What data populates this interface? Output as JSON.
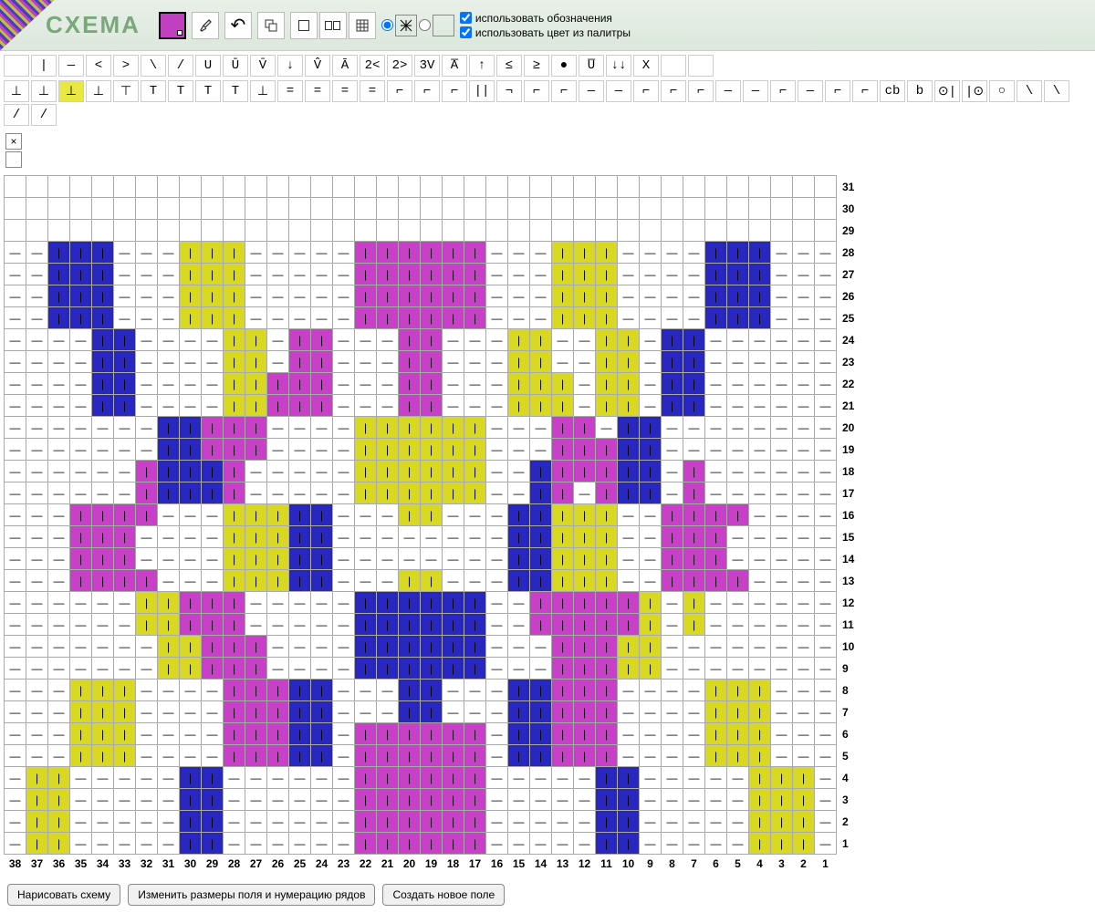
{
  "title": "CXEMA",
  "toolbar": {
    "fill_color": "#c840c8",
    "eyedropper": "eyedropper",
    "undo": "↶",
    "copy": "copy",
    "rect_outline": "▢",
    "rect_fill": "▬",
    "grid_single": "grid",
    "radio1_active": true,
    "radio2_active": false
  },
  "checkboxes": {
    "use_symbols": {
      "label": "использовать обозначения",
      "checked": true
    },
    "use_palette_color": {
      "label": "использовать цвет из палитры",
      "checked": true
    }
  },
  "symbol_rows": [
    [
      " ",
      "|",
      "—",
      "<",
      ">",
      "\\",
      "/",
      "U",
      "Ū",
      "V̄",
      "↓",
      "V̂",
      "Ā",
      "2<",
      "2>",
      "3V",
      "A̅",
      "↑",
      "≤",
      "≥",
      "●",
      "U̅",
      "↓↓",
      "X",
      " ",
      " "
    ],
    [
      "⊥",
      "⊥",
      "⊥",
      "⊥",
      "⊤",
      "T",
      "T",
      "T",
      "T",
      "⊥",
      "=",
      "=",
      "=",
      "=",
      "⌐",
      "⌐",
      "⌐",
      "||",
      "¬",
      "⌐",
      "⌐",
      "—",
      "—",
      "⌐",
      "⌐",
      "⌐",
      "—",
      "—",
      "⌐",
      "—",
      "⌐",
      "⌐",
      "cb",
      "b",
      "⊙|",
      "|⊙",
      "○",
      "\\",
      "\\",
      "/",
      "/"
    ]
  ],
  "symbol_selected": {
    "row": 1,
    "col": 2
  },
  "extra": {
    "close": "×",
    "blank": ""
  },
  "grid": {
    "rows": 31,
    "cols": 38,
    "row_labels_right": [
      31,
      30,
      29,
      28,
      27,
      26,
      25,
      24,
      23,
      22,
      21,
      20,
      19,
      18,
      17,
      16,
      15,
      14,
      13,
      12,
      11,
      10,
      9,
      8,
      7,
      6,
      5,
      4,
      3,
      2,
      1
    ],
    "col_labels_bottom": [
      38,
      37,
      36,
      35,
      34,
      33,
      32,
      31,
      30,
      29,
      28,
      27,
      26,
      25,
      24,
      23,
      22,
      21,
      20,
      19,
      18,
      17,
      16,
      15,
      14,
      13,
      12,
      11,
      10,
      9,
      8,
      7,
      6,
      5,
      4,
      3,
      2,
      1
    ],
    "colors": {
      "m": "#c840c8",
      "b": "#2828c0",
      "y": "#d8d820"
    },
    "cells": {
      "28": {
        "36": "b",
        "35": "b",
        "34": "b",
        "30": "y",
        "29": "y",
        "28": "y",
        "22": "m",
        "21": "m",
        "20": "m",
        "19": "m",
        "18": "m",
        "17": "m",
        "13": "y",
        "12": "y",
        "11": "y",
        "6": "b",
        "5": "b",
        "4": "b"
      },
      "27": {
        "36": "b",
        "35": "b",
        "34": "b",
        "30": "y",
        "29": "y",
        "28": "y",
        "22": "m",
        "21": "m",
        "20": "m",
        "19": "m",
        "18": "m",
        "17": "m",
        "13": "y",
        "12": "y",
        "11": "y",
        "6": "b",
        "5": "b",
        "4": "b"
      },
      "26": {
        "36": "b",
        "35": "b",
        "34": "b",
        "30": "y",
        "29": "y",
        "28": "y",
        "22": "m",
        "21": "m",
        "20": "m",
        "19": "m",
        "18": "m",
        "17": "m",
        "13": "y",
        "12": "y",
        "11": "y",
        "6": "b",
        "5": "b",
        "4": "b"
      },
      "25": {
        "36": "b",
        "35": "b",
        "34": "b",
        "30": "y",
        "29": "y",
        "28": "y",
        "22": "m",
        "21": "m",
        "20": "m",
        "19": "m",
        "18": "m",
        "17": "m",
        "13": "y",
        "12": "y",
        "11": "y",
        "6": "b",
        "5": "b",
        "4": "b"
      },
      "24": {
        "34": "b",
        "33": "b",
        "28": "y",
        "27": "y",
        "25": "m",
        "24": "m",
        "20": "m",
        "19": "m",
        "15": "y",
        "14": "y",
        "11": "y",
        "10": "y",
        "8": "b",
        "7": "b"
      },
      "23": {
        "34": "b",
        "33": "b",
        "28": "y",
        "27": "y",
        "25": "m",
        "24": "m",
        "20": "m",
        "19": "m",
        "15": "y",
        "14": "y",
        "11": "y",
        "10": "y",
        "8": "b",
        "7": "b"
      },
      "22": {
        "34": "b",
        "33": "b",
        "28": "y",
        "27": "y",
        "26": "m",
        "25": "m",
        "24": "m",
        "20": "m",
        "19": "m",
        "15": "y",
        "14": "y",
        "13": "y",
        "11": "y",
        "10": "y",
        "8": "b",
        "7": "b"
      },
      "21": {
        "34": "b",
        "33": "b",
        "28": "y",
        "27": "y",
        "26": "m",
        "25": "m",
        "24": "m",
        "20": "m",
        "19": "m",
        "15": "y",
        "14": "y",
        "13": "y",
        "11": "y",
        "10": "y",
        "8": "b",
        "7": "b"
      },
      "20": {
        "31": "b",
        "30": "b",
        "29": "m",
        "28": "m",
        "27": "m",
        "22": "y",
        "21": "y",
        "20": "y",
        "19": "y",
        "18": "y",
        "17": "y",
        "13": "m",
        "12": "m",
        "10": "b",
        "9": "b"
      },
      "19": {
        "31": "b",
        "30": "b",
        "29": "m",
        "28": "m",
        "27": "m",
        "22": "y",
        "21": "y",
        "20": "y",
        "19": "y",
        "18": "y",
        "17": "y",
        "13": "m",
        "12": "m",
        "11": "m",
        "10": "b",
        "9": "b"
      },
      "18": {
        "32": "m",
        "31": "b",
        "30": "b",
        "29": "b",
        "28": "m",
        "22": "y",
        "21": "y",
        "20": "y",
        "19": "y",
        "18": "y",
        "17": "y",
        "14": "b",
        "13": "m",
        "12": "m",
        "11": "m",
        "10": "b",
        "9": "b",
        "7": "m"
      },
      "17": {
        "32": "m",
        "31": "b",
        "30": "b",
        "29": "b",
        "28": "m",
        "22": "y",
        "21": "y",
        "20": "y",
        "19": "y",
        "18": "y",
        "17": "y",
        "14": "b",
        "13": "m",
        "11": "m",
        "10": "b",
        "9": "b",
        "7": "m"
      },
      "16": {
        "35": "m",
        "34": "m",
        "33": "m",
        "32": "m",
        "28": "y",
        "27": "y",
        "26": "y",
        "25": "b",
        "24": "b",
        "20": "y",
        "19": "y",
        "15": "b",
        "14": "b",
        "13": "y",
        "12": "y",
        "11": "y",
        "8": "m",
        "7": "m",
        "6": "m",
        "5": "m"
      },
      "15": {
        "35": "m",
        "34": "m",
        "33": "m",
        "28": "y",
        "27": "y",
        "26": "y",
        "25": "b",
        "24": "b",
        "15": "b",
        "14": "b",
        "13": "y",
        "12": "y",
        "11": "y",
        "8": "m",
        "7": "m",
        "6": "m"
      },
      "14": {
        "35": "m",
        "34": "m",
        "33": "m",
        "28": "y",
        "27": "y",
        "26": "y",
        "25": "b",
        "24": "b",
        "15": "b",
        "14": "b",
        "13": "y",
        "12": "y",
        "11": "y",
        "8": "m",
        "7": "m",
        "6": "m"
      },
      "13": {
        "35": "m",
        "34": "m",
        "33": "m",
        "32": "m",
        "28": "y",
        "27": "y",
        "26": "y",
        "25": "b",
        "24": "b",
        "20": "y",
        "19": "y",
        "15": "b",
        "14": "b",
        "13": "y",
        "12": "y",
        "11": "y",
        "8": "m",
        "7": "m",
        "6": "m",
        "5": "m"
      },
      "12": {
        "32": "y",
        "31": "y",
        "30": "m",
        "29": "m",
        "28": "m",
        "22": "b",
        "21": "b",
        "20": "b",
        "19": "b",
        "18": "b",
        "17": "b",
        "14": "m",
        "13": "m",
        "12": "m",
        "11": "m",
        "10": "m",
        "9": "y",
        "7": "y"
      },
      "11": {
        "32": "y",
        "31": "y",
        "30": "m",
        "29": "m",
        "28": "m",
        "22": "b",
        "21": "b",
        "20": "b",
        "19": "b",
        "18": "b",
        "17": "b",
        "14": "m",
        "13": "m",
        "12": "m",
        "11": "m",
        "10": "m",
        "9": "y",
        "7": "y"
      },
      "10": {
        "31": "y",
        "30": "y",
        "29": "m",
        "28": "m",
        "27": "m",
        "22": "b",
        "21": "b",
        "20": "b",
        "19": "b",
        "18": "b",
        "17": "b",
        "13": "m",
        "12": "m",
        "11": "m",
        "10": "y",
        "9": "y"
      },
      "9": {
        "31": "y",
        "30": "y",
        "29": "m",
        "28": "m",
        "27": "m",
        "22": "b",
        "21": "b",
        "20": "b",
        "19": "b",
        "18": "b",
        "17": "b",
        "13": "m",
        "12": "m",
        "11": "m",
        "10": "y",
        "9": "y"
      },
      "8": {
        "35": "y",
        "34": "y",
        "33": "y",
        "28": "m",
        "27": "m",
        "26": "m",
        "25": "b",
        "24": "b",
        "20": "b",
        "19": "b",
        "15": "b",
        "14": "b",
        "13": "m",
        "12": "m",
        "11": "m",
        "6": "y",
        "5": "y",
        "4": "y"
      },
      "7": {
        "35": "y",
        "34": "y",
        "33": "y",
        "28": "m",
        "27": "m",
        "26": "m",
        "25": "b",
        "24": "b",
        "20": "b",
        "19": "b",
        "15": "b",
        "14": "b",
        "13": "m",
        "12": "m",
        "11": "m",
        "6": "y",
        "5": "y",
        "4": "y"
      },
      "6": {
        "35": "y",
        "34": "y",
        "33": "y",
        "28": "m",
        "27": "m",
        "26": "m",
        "25": "b",
        "24": "b",
        "22": "m",
        "21": "m",
        "20": "m",
        "19": "m",
        "18": "m",
        "17": "m",
        "15": "b",
        "14": "b",
        "13": "m",
        "12": "m",
        "11": "m",
        "6": "y",
        "5": "y",
        "4": "y"
      },
      "5": {
        "35": "y",
        "34": "y",
        "33": "y",
        "28": "m",
        "27": "m",
        "26": "m",
        "25": "b",
        "24": "b",
        "22": "m",
        "21": "m",
        "20": "m",
        "19": "m",
        "18": "m",
        "17": "m",
        "15": "b",
        "14": "b",
        "13": "m",
        "12": "m",
        "11": "m",
        "6": "y",
        "5": "y",
        "4": "y"
      },
      "4": {
        "37": "y",
        "36": "y",
        "30": "b",
        "29": "b",
        "22": "m",
        "21": "m",
        "20": "m",
        "19": "m",
        "18": "m",
        "17": "m",
        "11": "b",
        "10": "b",
        "4": "y",
        "3": "y",
        "2": "y"
      },
      "3": {
        "37": "y",
        "36": "y",
        "30": "b",
        "29": "b",
        "22": "m",
        "21": "m",
        "20": "m",
        "19": "m",
        "18": "m",
        "17": "m",
        "11": "b",
        "10": "b",
        "4": "y",
        "3": "y",
        "2": "y"
      },
      "2": {
        "37": "y",
        "36": "y",
        "30": "b",
        "29": "b",
        "22": "m",
        "21": "m",
        "20": "m",
        "19": "m",
        "18": "m",
        "17": "m",
        "11": "b",
        "10": "b",
        "4": "y",
        "3": "y",
        "2": "y"
      },
      "1": {
        "37": "y",
        "36": "y",
        "30": "b",
        "29": "b",
        "22": "m",
        "21": "m",
        "20": "m",
        "19": "m",
        "18": "m",
        "17": "m",
        "11": "b",
        "10": "b",
        "4": "y",
        "3": "y",
        "2": "y"
      }
    },
    "stitch_rows_knit": [
      1,
      3,
      5,
      7,
      9,
      11,
      13,
      15,
      17,
      19,
      21,
      23,
      25,
      27,
      28
    ],
    "stitch_rows_purl_block": [
      2,
      4,
      6,
      8,
      10,
      12,
      14,
      16,
      18,
      20,
      22,
      24,
      26
    ]
  },
  "footer": {
    "draw": "Нарисовать схему",
    "resize": "Изменить размеры поля и нумерацию рядов",
    "new": "Создать новое поле"
  }
}
